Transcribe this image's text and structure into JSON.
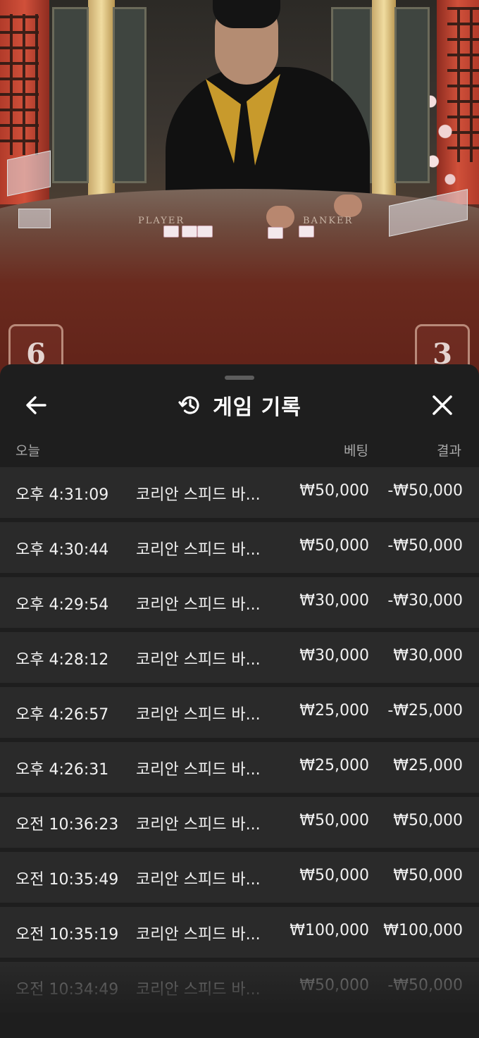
{
  "scene": {
    "table_label_player": "PLAYER",
    "table_label_banker": "BANKER",
    "player_score": "6",
    "banker_score": "3"
  },
  "sheet": {
    "title": "게임 기록",
    "icons": {
      "back": "arrow-left-icon",
      "history": "history-icon",
      "close": "close-icon"
    },
    "columns": {
      "date": "오늘",
      "bet": "베팅",
      "result": "결과"
    },
    "rows": [
      {
        "time": "오후 4:31:09",
        "game": "코리안 스피드 바...",
        "bet": "₩50,000",
        "result": "-₩50,000"
      },
      {
        "time": "오후 4:30:44",
        "game": "코리안 스피드 바...",
        "bet": "₩50,000",
        "result": "-₩50,000"
      },
      {
        "time": "오후 4:29:54",
        "game": "코리안 스피드 바...",
        "bet": "₩30,000",
        "result": "-₩30,000"
      },
      {
        "time": "오후 4:28:12",
        "game": "코리안 스피드 바...",
        "bet": "₩30,000",
        "result": "₩30,000"
      },
      {
        "time": "오후 4:26:57",
        "game": "코리안 스피드 바...",
        "bet": "₩25,000",
        "result": "-₩25,000"
      },
      {
        "time": "오후 4:26:31",
        "game": "코리안 스피드 바...",
        "bet": "₩25,000",
        "result": "₩25,000"
      },
      {
        "time": "오전 10:36:23",
        "game": "코리안 스피드 바...",
        "bet": "₩50,000",
        "result": "₩50,000"
      },
      {
        "time": "오전 10:35:49",
        "game": "코리안 스피드 바...",
        "bet": "₩50,000",
        "result": "₩50,000"
      },
      {
        "time": "오전 10:35:19",
        "game": "코리안 스피드 바...",
        "bet": "₩100,000",
        "result": "₩100,000"
      },
      {
        "time": "오전 10:34:49",
        "game": "코리안 스피드 바...",
        "bet": "₩50,000",
        "result": "-₩50,000"
      }
    ]
  }
}
